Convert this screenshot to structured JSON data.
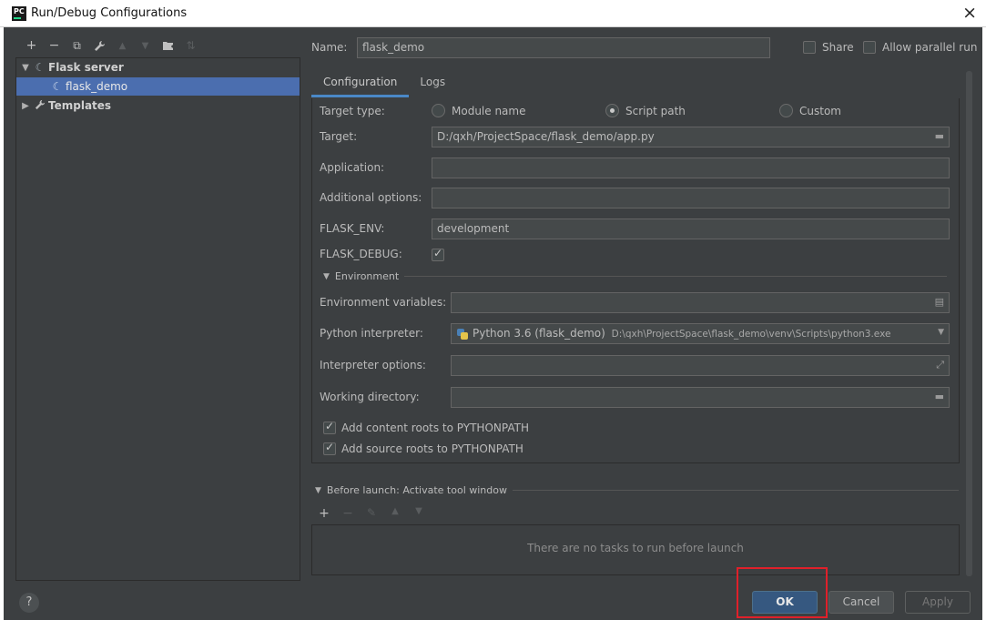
{
  "window": {
    "title": "Run/Debug Configurations",
    "app_icon": "pycharm-icon",
    "close_glyph": "×"
  },
  "left_toolbar": [
    {
      "name": "add-icon",
      "glyph": "+",
      "enabled": true
    },
    {
      "name": "remove-icon",
      "glyph": "−",
      "enabled": true
    },
    {
      "name": "copy-icon",
      "glyph": "⧉",
      "enabled": true
    },
    {
      "name": "wrench-icon",
      "glyph": "🔧",
      "enabled": true
    },
    {
      "name": "move-up-icon",
      "glyph": "▲",
      "enabled": false
    },
    {
      "name": "move-down-icon",
      "glyph": "▼",
      "enabled": false
    },
    {
      "name": "folder-icon",
      "glyph": "▆",
      "enabled": true
    },
    {
      "name": "sort-icon",
      "glyph": "⇅",
      "enabled": false
    }
  ],
  "tree": {
    "group": {
      "label": "Flask server",
      "expand_glyph": "▼",
      "icon": "flask-icon"
    },
    "selected_item": {
      "label": "flask_demo",
      "icon": "flask-icon"
    },
    "templates": {
      "label": "Templates",
      "expand_glyph": "▶",
      "icon": "wrench-icon"
    }
  },
  "header": {
    "name_label": "Name:",
    "name_value": "flask_demo",
    "share_label": "Share",
    "share_checked": false,
    "parallel_label": "Allow parallel run",
    "parallel_checked": false
  },
  "tabs": [
    {
      "label": "Configuration",
      "active": true
    },
    {
      "label": "Logs",
      "active": false
    }
  ],
  "config": {
    "target_type_label": "Target type:",
    "target_type_options": [
      {
        "label": "Module name",
        "selected": false
      },
      {
        "label": "Script path",
        "selected": true
      },
      {
        "label": "Custom",
        "selected": false
      }
    ],
    "target_label": "Target:",
    "target_value": "D:/qxh/ProjectSpace/flask_demo/app.py",
    "application_label": "Application:",
    "application_value": "",
    "additional_options_label": "Additional options:",
    "additional_options_value": "",
    "flask_env_label": "FLASK_ENV:",
    "flask_env_value": "development",
    "flask_debug_label": "FLASK_DEBUG:",
    "flask_debug_checked": true,
    "environment_section": "Environment",
    "env_vars_label": "Environment variables:",
    "env_vars_value": "",
    "interpreter_label": "Python interpreter:",
    "interpreter_name": "Python 3.6 (flask_demo)",
    "interpreter_path": "D:\\qxh\\ProjectSpace\\flask_demo\\venv\\Scripts\\python3.exe",
    "interpreter_options_label": "Interpreter options:",
    "interpreter_options_value": "",
    "working_dir_label": "Working directory:",
    "working_dir_value": "",
    "content_roots_label": "Add content roots to PYTHONPATH",
    "content_roots_checked": true,
    "source_roots_label": "Add source roots to PYTHONPATH",
    "source_roots_checked": true
  },
  "before_launch": {
    "title": "Before launch: Activate tool window",
    "empty_text": "There are no tasks to run before launch"
  },
  "footer": {
    "help_glyph": "?",
    "ok_label": "OK",
    "cancel_label": "Cancel",
    "apply_label": "Apply",
    "apply_enabled": false
  },
  "colors": {
    "accent": "#4b6eaf",
    "ok_button": "#365880",
    "highlight_box": "#e0202a"
  }
}
